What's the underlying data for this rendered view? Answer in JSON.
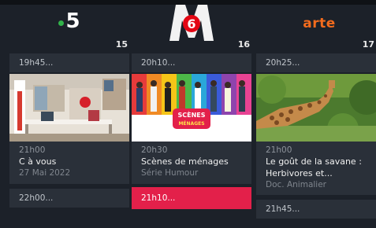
{
  "channels": [
    {
      "logo_text": "5",
      "number": "15",
      "prev_slot": "19h45...",
      "program": {
        "time": "21h00",
        "title": "C à vous",
        "subtitle": "27 Mai 2022"
      },
      "next_slot": "22h00..."
    },
    {
      "logo_text": "M6",
      "number": "16",
      "prev_slot": "20h10...",
      "program": {
        "time": "20h30",
        "title": "Scènes de ménages",
        "subtitle": "Série Humour"
      },
      "next_slot": "21h10...",
      "thumb_text_1": "SCÈNES",
      "thumb_text_2": "MÉNAGES"
    },
    {
      "logo_text": "arte",
      "number": "17",
      "prev_slot": "20h25...",
      "program": {
        "time": "21h00",
        "title_line1": "Le goût de la savane :",
        "title_line2": "Herbivores et...",
        "subtitle": "Doc. Animalier"
      },
      "next_slot": "21h45..."
    }
  ],
  "colors": {
    "background": "#1c2129",
    "tile": "#2a3039",
    "active_slot": "#e3204a",
    "france5_green": "#32b34a",
    "m6_red": "#e30613",
    "arte_orange": "#f26b1d"
  }
}
